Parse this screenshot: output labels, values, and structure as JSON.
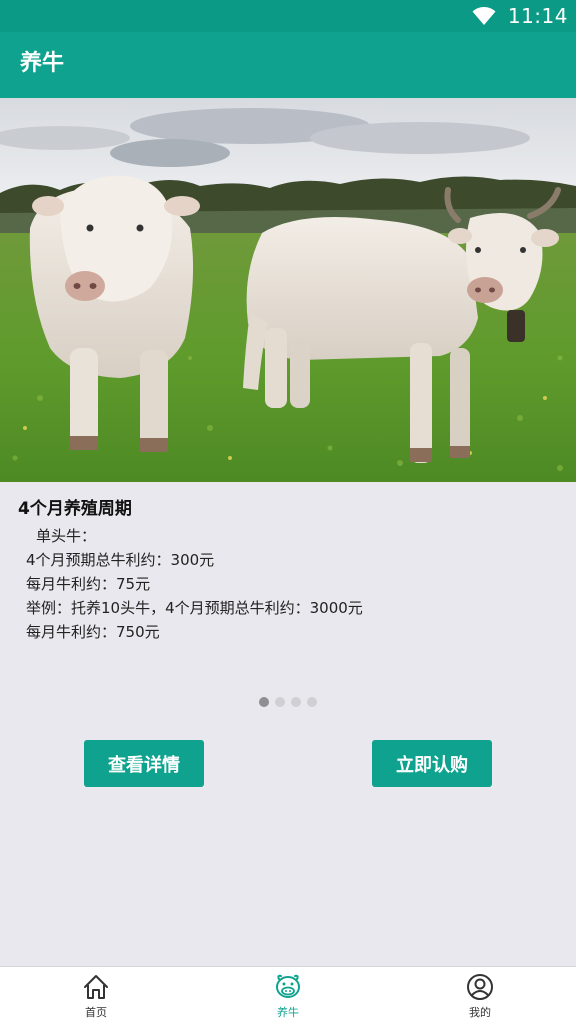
{
  "status_bar": {
    "time": "11:14",
    "wifi_icon": "wifi-icon"
  },
  "app_bar": {
    "title": "养牛"
  },
  "hero": {
    "image": "two-white-cows-in-pasture"
  },
  "info": {
    "heading": "4个月养殖周期",
    "lines": [
      "单头牛：",
      "4个月预期总牛利约：300元",
      "每月牛利约：75元",
      "举例：托养10头牛，4个月预期总牛利约：3000元",
      "每月牛利约：750元"
    ]
  },
  "pager": {
    "count": 4,
    "active": 1
  },
  "buttons": {
    "detail": "查看详情",
    "buy": "立即认购"
  },
  "tabs": [
    {
      "label": "首页",
      "icon": "home-icon",
      "active": false
    },
    {
      "label": "养牛",
      "icon": "cow-icon",
      "active": true
    },
    {
      "label": "我的",
      "icon": "user-icon",
      "active": false
    }
  ],
  "colors": {
    "primary": "#0fa38f",
    "status_bar": "#0b9a86",
    "background": "#e9e8ee"
  }
}
